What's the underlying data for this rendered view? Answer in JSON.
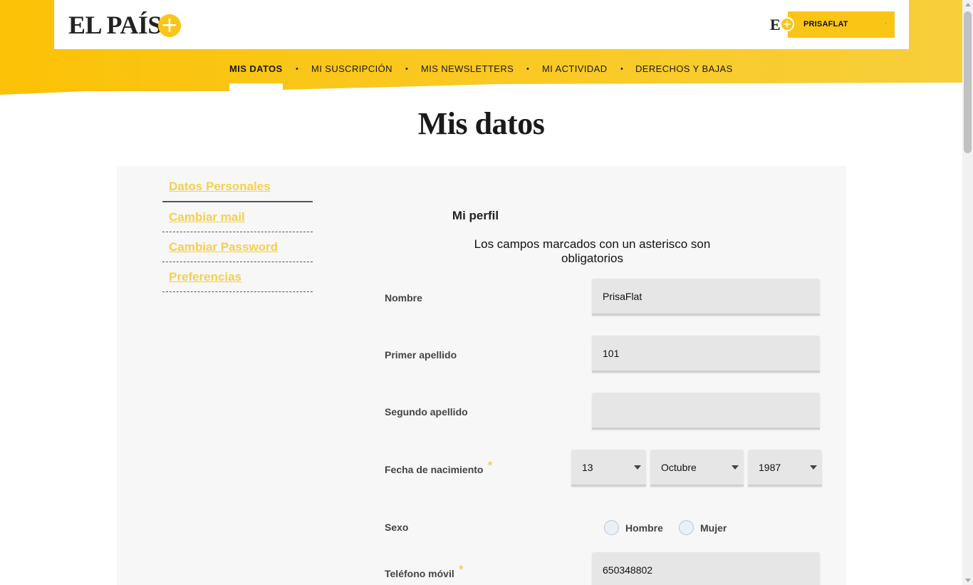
{
  "header": {
    "logo_text": "EL PAÍS",
    "logo_plus": "+",
    "user_e": "E",
    "user_plus": "+",
    "user_name": "PRISAFLAT",
    "user_dot": "·"
  },
  "nav": {
    "items": [
      {
        "label": "MIS DATOS",
        "active": true
      },
      {
        "label": "MI SUSCRIPCIÓN",
        "active": false
      },
      {
        "label": "MIS NEWSLETTERS",
        "active": false
      },
      {
        "label": "MI ACTIVIDAD",
        "active": false
      },
      {
        "label": "DERECHOS Y BAJAS",
        "active": false
      }
    ],
    "separator": "•"
  },
  "page": {
    "title": "Mis datos"
  },
  "side_menu": {
    "items": [
      {
        "label": "Datos Personales"
      },
      {
        "label": "Cambiar mail"
      },
      {
        "label": "Cambiar Password"
      },
      {
        "label": "Preferencias"
      }
    ]
  },
  "profile": {
    "title": "Mi perfil",
    "note": "Los campos marcados con un asterisco son obligatorios",
    "required_mark": "*",
    "fields": {
      "nombre": {
        "label": "Nombre",
        "value": "PrisaFlat"
      },
      "primer_apellido": {
        "label": "Primer apellido",
        "value": "101"
      },
      "segundo_apellido": {
        "label": "Segundo apellido",
        "value": ""
      },
      "fecha_nacimiento": {
        "label": "Fecha de nacimiento",
        "day": "13",
        "month": "Octubre",
        "year": "1987"
      },
      "sexo": {
        "label": "Sexo",
        "option_male": "Hombre",
        "option_female": "Mujer"
      },
      "telefono": {
        "label": "Teléfono móvil",
        "value": "650348802"
      }
    }
  },
  "colors": {
    "brand_yellow": "#fbc516",
    "link_yellow": "#f7cf4c",
    "panel_bg": "#f7f7f7",
    "input_bg": "#e6e6e6"
  },
  "icons": {
    "logo_plus": "plus-circle-icon",
    "select_arrow": "caret-down-icon"
  }
}
